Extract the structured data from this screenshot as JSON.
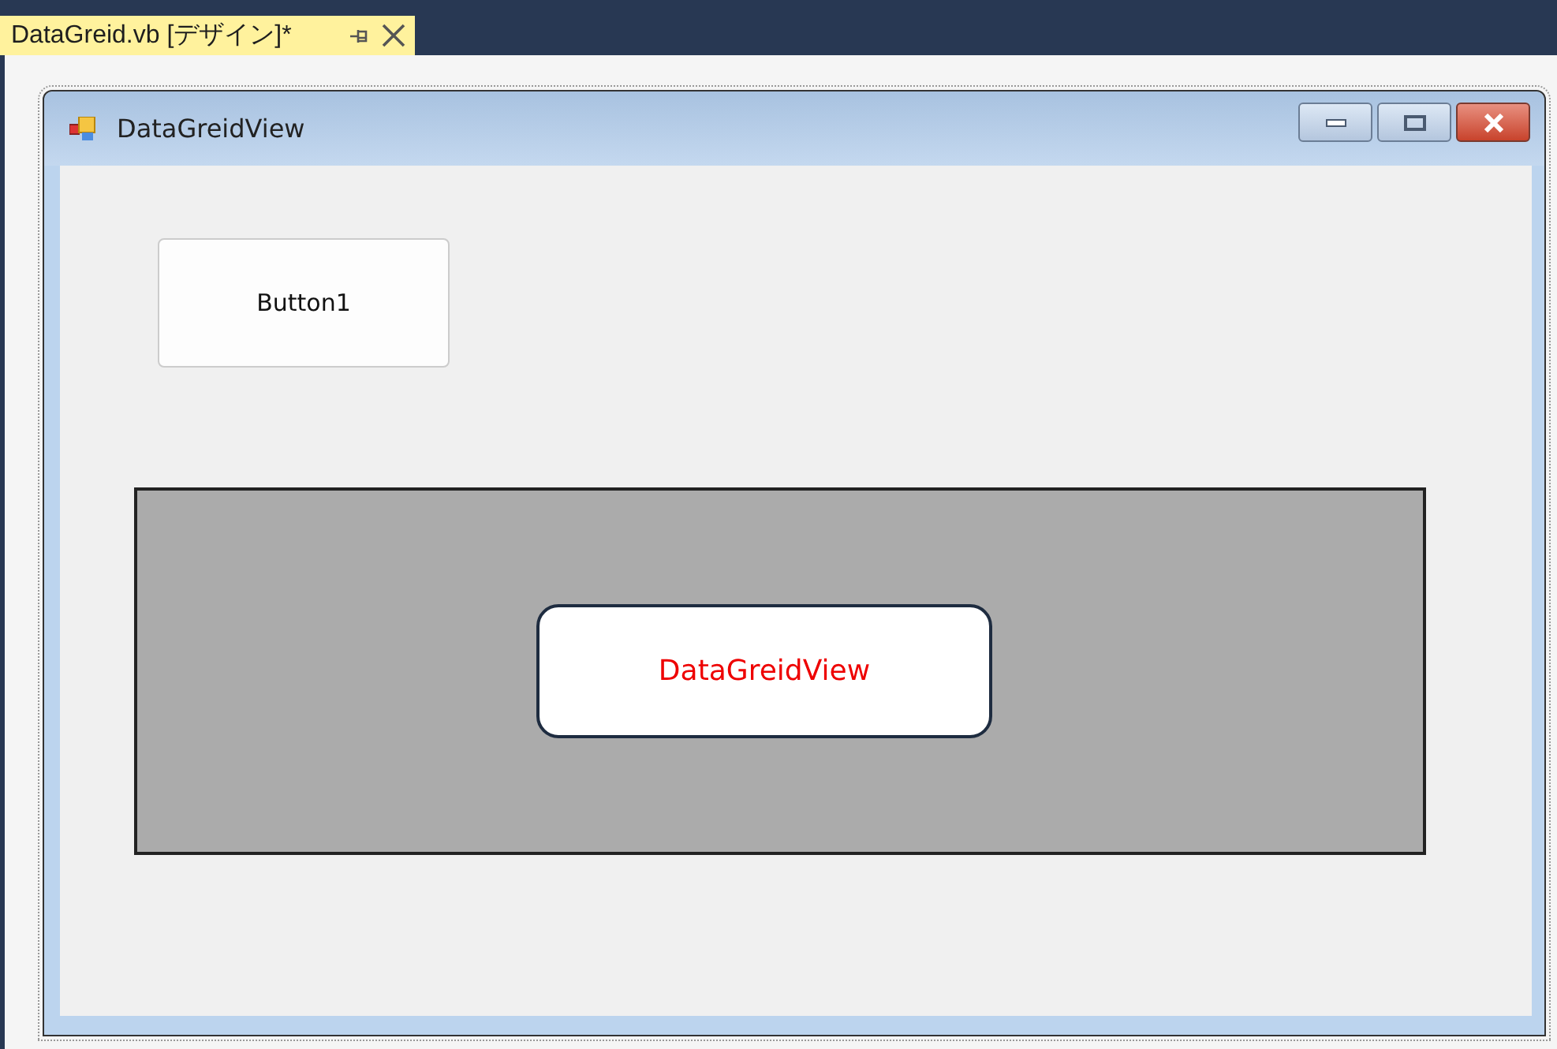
{
  "document_tab": {
    "title": "DataGreid.vb [デザイン]*",
    "selected": true
  },
  "form": {
    "title": "DataGreidView",
    "button": {
      "label": "Button1"
    },
    "data_grid_view": {
      "callout": "DataGreidView"
    }
  }
}
